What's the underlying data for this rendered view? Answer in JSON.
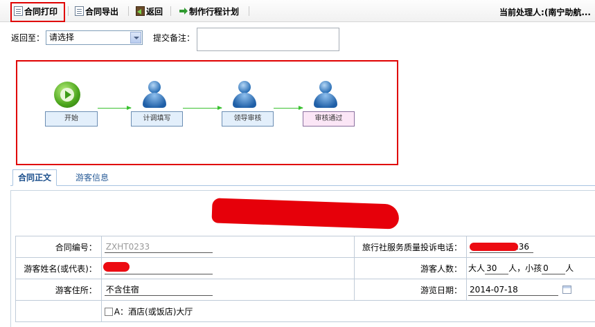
{
  "toolbar": {
    "print_label": "合同打印",
    "export_label": "合同导出",
    "back_label": "返回",
    "plan_label": "制作行程计划",
    "handler_label": "当前处理人:(南宁助航..."
  },
  "return_row": {
    "return_to_label": "返回至：",
    "return_to_value": "请选择",
    "remark_label": "提交备注："
  },
  "workflow": {
    "nodes": [
      "开始",
      "计调填写",
      "领导审核",
      "审核通过"
    ]
  },
  "tabs": {
    "contract_body": "合同正文",
    "tourist_info": "游客信息"
  },
  "form": {
    "contract_no_label": "合同编号：",
    "contract_no_value": "ZXHT0233",
    "complaint_phone_label": "旅行社服务质量投诉电话：",
    "complaint_phone_value": "136",
    "tourist_name_label": "游客姓名(或代表)：",
    "tourist_count_label": "游客人数：",
    "adult_prefix": "大人",
    "adult_count": "30",
    "adult_suffix": "人，小孩",
    "child_count": "0",
    "child_suffix": "人",
    "residence_label": "游客住所：",
    "residence_value": "不含住宿",
    "tour_date_label": "游览日期：",
    "tour_date_value": "2014-07-18",
    "option_a_label": "A：酒店(或饭店)大厅"
  },
  "colors": {
    "highlight_red": "#e00000",
    "flow_arrow": "#39c12f",
    "tab_text": "#1b4f8c"
  }
}
